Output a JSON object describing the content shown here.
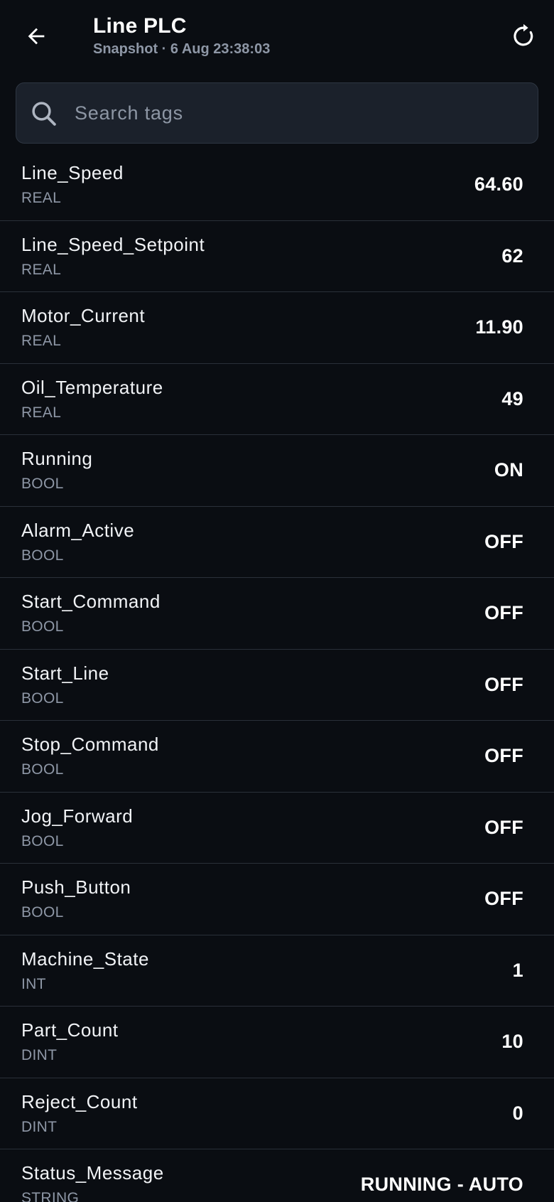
{
  "header": {
    "title": "Line PLC",
    "subtitle": "Snapshot · 6 Aug 23:38:03",
    "back_icon": "arrow-left-icon",
    "refresh_icon": "refresh-icon"
  },
  "search": {
    "placeholder": "Search tags",
    "value": "",
    "icon": "search-icon"
  },
  "colors": {
    "background": "#0a0d12",
    "search_bg": "#1b212b",
    "divider": "#2a3039",
    "secondary_text": "#8e97a6"
  },
  "tags": [
    {
      "name": "Line_Speed",
      "type": "REAL",
      "value": "64.60"
    },
    {
      "name": "Line_Speed_Setpoint",
      "type": "REAL",
      "value": "62"
    },
    {
      "name": "Motor_Current",
      "type": "REAL",
      "value": "11.90"
    },
    {
      "name": "Oil_Temperature",
      "type": "REAL",
      "value": "49"
    },
    {
      "name": "Running",
      "type": "BOOL",
      "value": "ON"
    },
    {
      "name": "Alarm_Active",
      "type": "BOOL",
      "value": "OFF"
    },
    {
      "name": "Start_Command",
      "type": "BOOL",
      "value": "OFF"
    },
    {
      "name": "Start_Line",
      "type": "BOOL",
      "value": "OFF"
    },
    {
      "name": "Stop_Command",
      "type": "BOOL",
      "value": "OFF"
    },
    {
      "name": "Jog_Forward",
      "type": "BOOL",
      "value": "OFF"
    },
    {
      "name": "Push_Button",
      "type": "BOOL",
      "value": "OFF"
    },
    {
      "name": "Machine_State",
      "type": "INT",
      "value": "1"
    },
    {
      "name": "Part_Count",
      "type": "DINT",
      "value": "10"
    },
    {
      "name": "Reject_Count",
      "type": "DINT",
      "value": "0"
    },
    {
      "name": "Status_Message",
      "type": "STRING",
      "value": "RUNNING - AUTO"
    }
  ]
}
